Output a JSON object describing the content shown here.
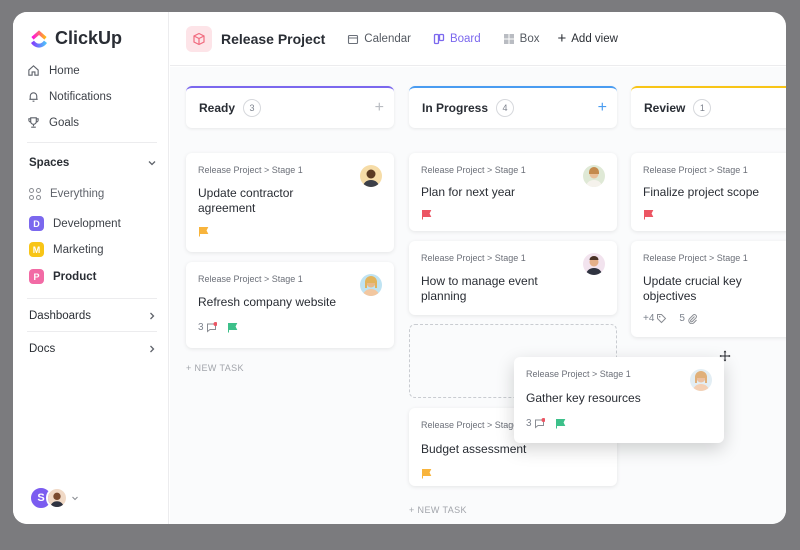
{
  "app": {
    "name": "ClickUp"
  },
  "nav": [
    {
      "label": "Home",
      "icon": "home-icon"
    },
    {
      "label": "Notifications",
      "icon": "bell-icon"
    },
    {
      "label": "Goals",
      "icon": "trophy-icon"
    }
  ],
  "spaces": {
    "title": "Spaces",
    "items": [
      {
        "label": "Everything",
        "letter": "",
        "color": ""
      },
      {
        "label": "Development",
        "letter": "D",
        "color": "#7b68ee"
      },
      {
        "label": "Marketing",
        "letter": "M",
        "color": "#f8c517"
      },
      {
        "label": "Product",
        "letter": "P",
        "color": "#f26aa5"
      }
    ]
  },
  "sections": [
    {
      "label": "Dashboards"
    },
    {
      "label": "Docs"
    }
  ],
  "user": {
    "initial": "S"
  },
  "header": {
    "project_title": "Release Project",
    "views": [
      {
        "label": "Calendar"
      },
      {
        "label": "Board"
      },
      {
        "label": "Box"
      }
    ],
    "add_view": "Add view"
  },
  "columns": [
    {
      "name": "Ready",
      "count": "3",
      "color": "#7b68ee"
    },
    {
      "name": "In Progress",
      "count": "4",
      "color": "#4a9cf1"
    },
    {
      "name": "Review",
      "count": "1",
      "color": "#f8c517"
    }
  ],
  "cards": [
    {
      "crumb": "Release Project > Stage 1",
      "title": "Update contractor agreement",
      "flag": "#f8b43c",
      "comments": "",
      "extra": ""
    },
    {
      "crumb": "Release Project > Stage 1",
      "title": "Refresh company website",
      "flag": "#3dc08a",
      "comments": "3",
      "extra": ""
    },
    {
      "crumb": "Release Project > Stage 1",
      "title": "Plan for next year",
      "flag": "#ec5563",
      "comments": "",
      "extra": ""
    },
    {
      "crumb": "Release Project > Stage 1",
      "title": "How to manage event planning",
      "flag": "",
      "comments": "",
      "extra": ""
    },
    {
      "crumb": "Release Project > Stage 1",
      "title": "Budget assessment",
      "flag": "#f8b43c",
      "comments": "",
      "extra": ""
    },
    {
      "crumb": "Release Project > Stage 1",
      "title": "Finalize project scope",
      "flag": "#ec5563",
      "comments": "",
      "extra": ""
    },
    {
      "crumb": "Release Project > Stage 1",
      "title": "Update crucial key objectives",
      "flag": "",
      "tags": "+4",
      "attachments": "5"
    },
    {
      "crumb": "Release Project > Stage 1",
      "title": "Gather key resources",
      "flag": "#3dc08a",
      "comments": "3"
    }
  ],
  "new_task_label": "+ NEW TASK"
}
